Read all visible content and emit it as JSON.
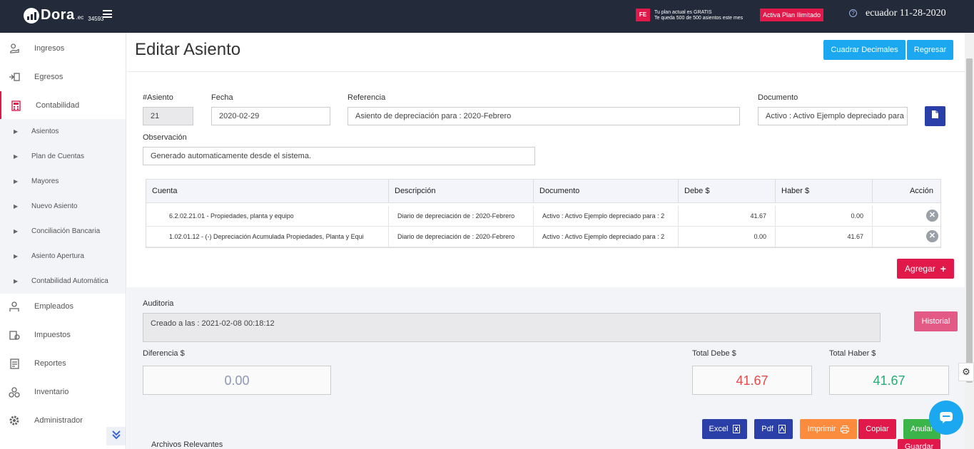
{
  "topbar": {
    "logo_text": "Dora",
    "logo_suffix": ".ec",
    "company_id": "34593",
    "fe_badge": "FE",
    "plan_line1": "Tu plan actual es GRATIS",
    "plan_line2": "Te queda 500 de 500 asientos este mes",
    "plan_button": "Activa Plan Ilimitado",
    "help_icon": "?",
    "region_date": "ecuador 11-28-2020"
  },
  "sidebar": {
    "items": [
      {
        "label": "Ingresos",
        "icon": "money-hand-icon"
      },
      {
        "label": "Egresos",
        "icon": "cash-out-icon"
      },
      {
        "label": "Contabilidad",
        "icon": "calculator-icon"
      },
      {
        "label": "Empleados",
        "icon": "employees-icon"
      },
      {
        "label": "Impuestos",
        "icon": "tax-icon"
      },
      {
        "label": "Reportes",
        "icon": "report-icon"
      },
      {
        "label": "Inventario",
        "icon": "inventory-icon"
      },
      {
        "label": "Administrador",
        "icon": "gear-icon"
      }
    ],
    "subitems": [
      "Asientos",
      "Plan de Cuentas",
      "Mayores",
      "Nuevo Asiento",
      "Conciliación Bancaria",
      "Asiento Apertura",
      "Contabilidad Automática"
    ]
  },
  "page": {
    "title": "Editar Asiento",
    "btn_cuadrar": "Cuadrar Decimales",
    "btn_regresar": "Regresar"
  },
  "form": {
    "asiento_label": "#Asiento",
    "asiento_value": "21",
    "fecha_label": "Fecha",
    "fecha_value": "2020-02-29",
    "referencia_label": "Referencia",
    "referencia_value": "Asiento de depreciación para : 2020-Febrero",
    "documento_label": "Documento",
    "documento_value": "Activo : Activo Ejemplo depreciado para",
    "observacion_label": "Observación",
    "observacion_value": "Generado automaticamente desde el sistema."
  },
  "grid": {
    "headers": [
      "Cuenta",
      "Descripción",
      "Documento",
      "Debe $",
      "Haber $",
      "Acción"
    ],
    "rows": [
      {
        "cuenta": "6.2.02.21.01 - Propiedades, planta y equipo",
        "descripcion": "Diario de depreciación de : 2020-Febrero",
        "documento": "Activo : Activo Ejemplo depreciado para : 2",
        "debe": "41.67",
        "haber": "0.00"
      },
      {
        "cuenta": "1.02.01.12 - (-) Depreciación Acumulada Propiedades, Planta y Equi",
        "descripcion": "Diario de depreciación de : 2020-Febrero",
        "documento": "Activo : Activo Ejemplo depreciado para : 2",
        "debe": "0.00",
        "haber": "41.67"
      }
    ],
    "delete_icon": "✕",
    "add_button": "Agregar"
  },
  "audit": {
    "label": "Auditoria",
    "value": "Creado a las : 2021-02-08 00:18:12",
    "historial": "Historial"
  },
  "totals": {
    "diferencia_label": "Diferencia $",
    "diferencia_value": "0.00",
    "debe_label": "Total Debe $",
    "debe_value": "41.67",
    "haber_label": "Total Haber $",
    "haber_value": "41.67"
  },
  "actions": {
    "excel": "Excel",
    "pdf": "Pdf",
    "imprimir": "Imprimir",
    "copiar": "Copiar",
    "anular": "Anular",
    "guardar": "Guardar"
  },
  "files": {
    "label": "Archivos Relevantes"
  },
  "colors": {
    "topbar": "#232a3a",
    "accent_red": "#e0194a",
    "sky": "#1ca8f0",
    "navy": "#2b3fa8",
    "debe_red": "#e44a4a",
    "haber_green": "#2aa876"
  }
}
